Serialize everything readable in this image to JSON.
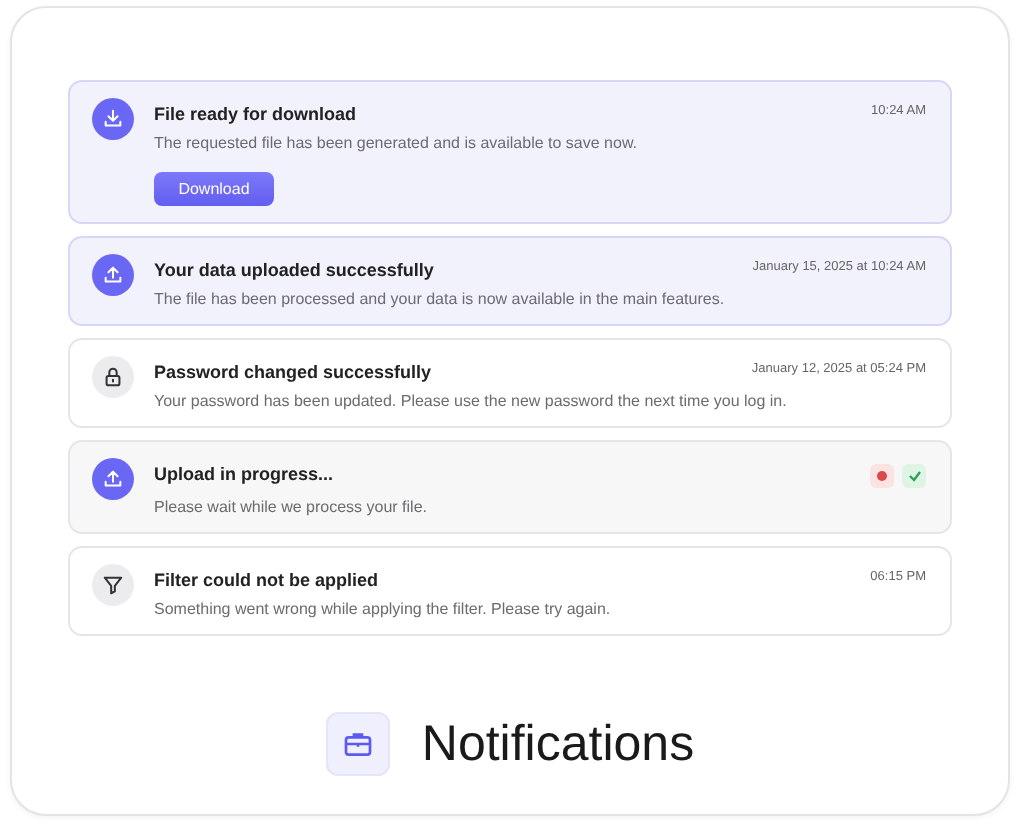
{
  "notifications": [
    {
      "kind": "download",
      "unread": true,
      "title": "File ready for download",
      "time": "10:24 AM",
      "message": "The requested file has been generated and is available to save now.",
      "action": "Download"
    },
    {
      "kind": "upload",
      "unread": true,
      "title": "Your data uploaded successfully",
      "time": "January 15, 2025 at 10:24 AM",
      "message": "The file has been processed and your data is now available in the main features."
    },
    {
      "kind": "lock",
      "unread": false,
      "title": "Password changed successfully",
      "time": "January 12, 2025 at 05:24 PM",
      "message": "Your password has been updated. Please use the new password the next time you log in."
    },
    {
      "kind": "upload",
      "unread": false,
      "in_progress": true,
      "title": "Upload in progress...",
      "message": "Please wait while we process your file.",
      "controls": true
    },
    {
      "kind": "filter",
      "unread": false,
      "title": "Filter could not be applied",
      "time": "06:15 PM",
      "message": "Something went wrong while applying the filter. Please try again."
    }
  ],
  "caption": "Notifications"
}
